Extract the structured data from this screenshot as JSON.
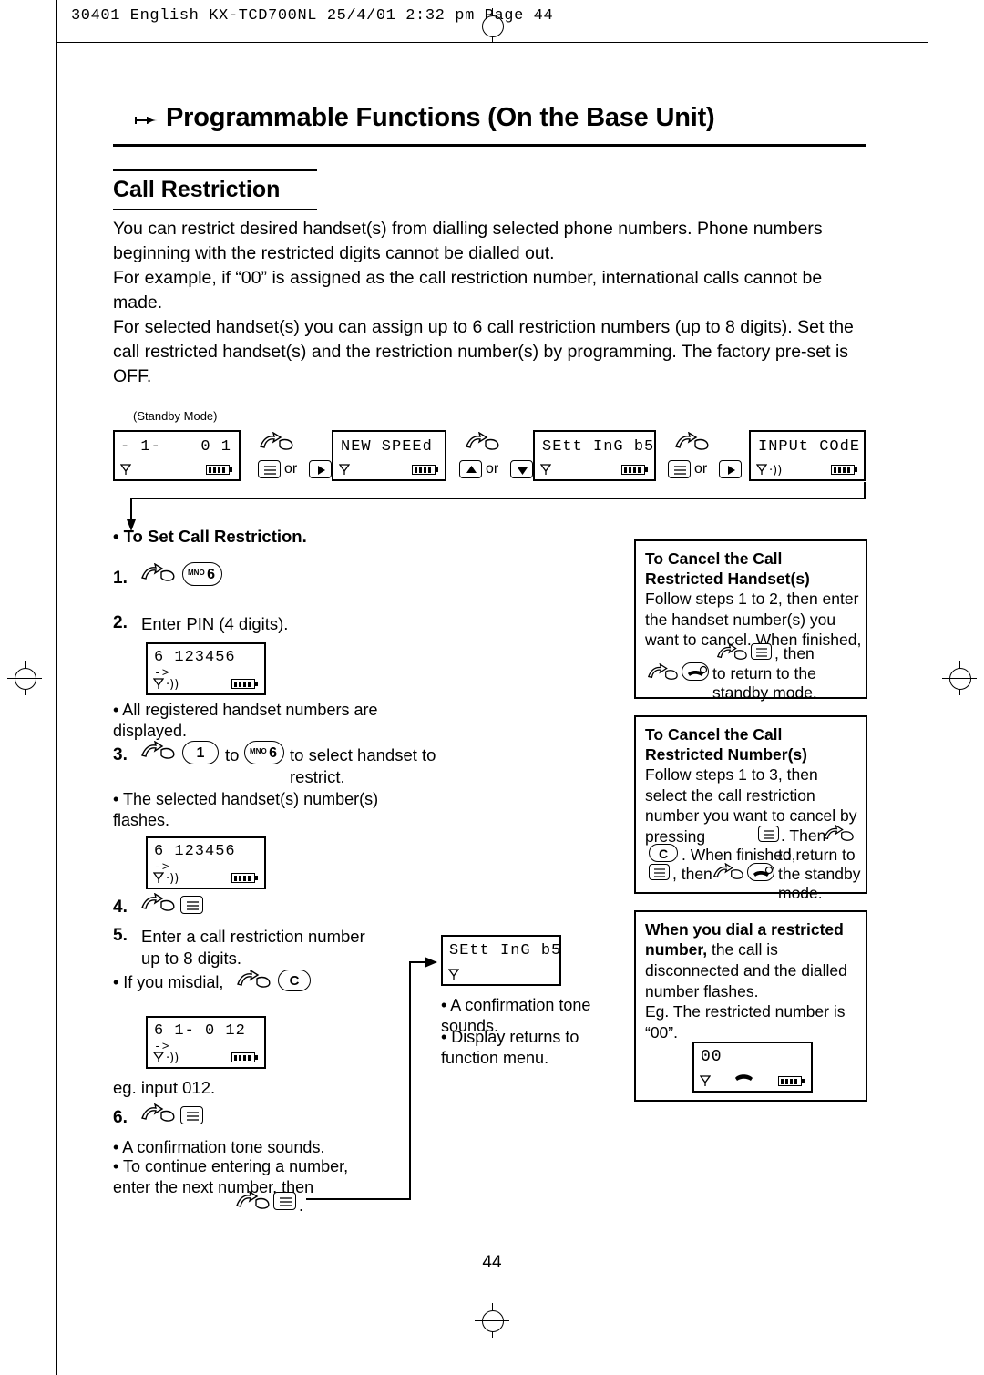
{
  "header": {
    "line": "30401 English KX-TCD700NL  25/4/01  2:32 pm  Page 44"
  },
  "title": {
    "text": "Programmable Functions (On the Base Unit)",
    "bullet_icon": "right-arrow-icon"
  },
  "section": {
    "title": "Call Restriction"
  },
  "intro": {
    "p1": "You can restrict desired handset(s) from dialling selected phone numbers. Phone numbers beginning with the restricted digits cannot be dialled out.",
    "p2": "For example, if “00” is assigned as the call restriction number, international calls cannot be made.",
    "p3": "For selected handset(s) you can assign up to 6 call restriction numbers (up to 8 digits). Set the call restricted handset(s) and the restriction number(s) by programming. The factory pre-set is OFF."
  },
  "flow": {
    "standby_label": "(Standby Mode)",
    "display1_left": "- 1-",
    "display1_right": "0 1",
    "display2": "NEW SPEEd",
    "display3": "SEtt InG b5",
    "display4": "INPUt COdE",
    "or1": "or",
    "or2": "or",
    "or3": "or",
    "key_menu": "menu-icon",
    "key_right": "right-arrow-key",
    "key_up": "up-arrow-key",
    "key_down": "down-arrow-key"
  },
  "procedure": {
    "heading": "• To Set Call Restriction.",
    "step1_num": "1.",
    "step1_key": "MNO 6",
    "step2_num": "2.",
    "step2_text": "Enter PIN (4 digits).",
    "display_pin": "6  123456",
    "note1": "• All registered handset numbers are displayed.",
    "step3_num": "3.",
    "step3_key_a": "1",
    "step3_mid": "to",
    "step3_key_b": "MNO 6",
    "step3_text": "to select handset to restrict.",
    "note2": "• The selected handset(s) number(s) flashes.",
    "display_handsets": "6  123456",
    "step4_num": "4.",
    "step5_num": "5.",
    "step5_text": "Enter a call restriction number up to 8 digits.",
    "note3": "• If you misdial,",
    "note3_key": "C",
    "display_number": "6  1- 0 12",
    "eg_text": "eg. input 012.",
    "step6_num": "6.",
    "note4": "• A confirmation tone sounds.",
    "note5": "• To continue entering a number, enter the next number, then",
    "note5_period": "."
  },
  "confirm": {
    "display": "SEtt InG b5",
    "note1": "• A confirmation tone sounds.",
    "note2": "• Display returns to function menu."
  },
  "sidebox1": {
    "title": "To Cancel the Call Restricted Handset(s)",
    "body_a": "Follow steps 1 to 2, then enter the handset number(s) you want to cancel. When finished,",
    "body_b": ", then",
    "body_c": "to return to the standby mode."
  },
  "sidebox2": {
    "title": "To Cancel the Call Restricted Number(s)",
    "body_a": "Follow steps 1 to 3, then select the call restriction number you want to cancel by pressing",
    "body_b": ". Then",
    "body_c": ". When finished,",
    "body_d": ", then",
    "body_e": "to return to the standby mode."
  },
  "sidebox3": {
    "title_bold": "When you dial a restricted number,",
    "title_rest": "the call is",
    "body": "disconnected and the dialled number flashes.",
    "body2": "Eg. The restricted number is “00”.",
    "display": "00"
  },
  "page_number": "44"
}
